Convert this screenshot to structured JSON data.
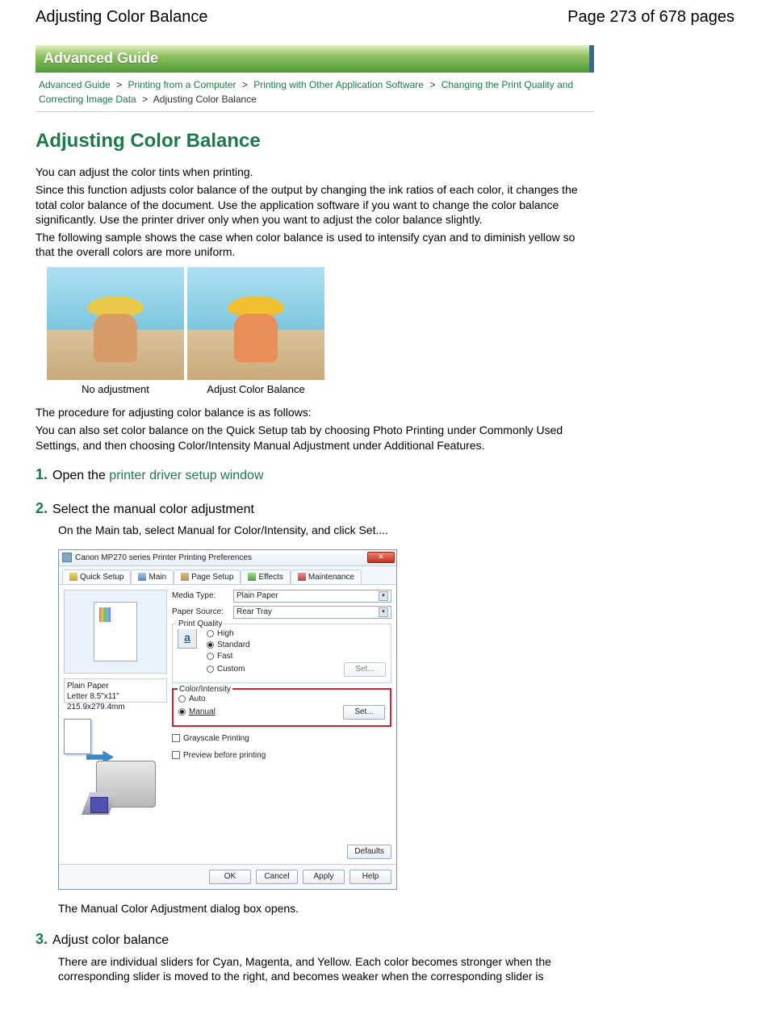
{
  "header": {
    "title_left": "Adjusting Color Balance",
    "title_right": "Page 273 of 678 pages"
  },
  "banner": "Advanced Guide",
  "breadcrumb": {
    "items": [
      {
        "label": "Advanced Guide",
        "link": true
      },
      {
        "label": "Printing from a Computer",
        "link": true
      },
      {
        "label": "Printing with Other Application Software",
        "link": true
      },
      {
        "label": "Changing the Print Quality and Correcting Image Data",
        "link": true
      }
    ],
    "sep": ">",
    "current": "Adjusting Color Balance"
  },
  "topic_title": "Adjusting Color Balance",
  "intro": {
    "p1": "You can adjust the color tints when printing.",
    "p2": "Since this function adjusts color balance of the output by changing the ink ratios of each color, it changes the total color balance of the document. Use the application software if you want to change the color balance significantly. Use the printer driver only when you want to adjust the color balance slightly.",
    "p3": "The following sample shows the case when color balance is used to intensify cyan and to diminish yellow so that the overall colors are more uniform."
  },
  "samples": {
    "caption_left": "No adjustment",
    "caption_right": "Adjust Color Balance"
  },
  "after_samples": {
    "p1": "The procedure for adjusting color balance is as follows:",
    "p2": "You can also set color balance on the Quick Setup tab by choosing Photo Printing under Commonly Used Settings, and then choosing Color/Intensity Manual Adjustment under Additional Features."
  },
  "steps": [
    {
      "num": "1.",
      "title_prefix": "Open the ",
      "title_link": "printer driver setup window",
      "title_suffix": ""
    },
    {
      "num": "2.",
      "title": "Select the manual color adjustment",
      "body1": "On the Main tab, select Manual for Color/Intensity, and click Set....",
      "body2": "The Manual Color Adjustment dialog box opens."
    },
    {
      "num": "3.",
      "title": "Adjust color balance",
      "body1": "There are individual sliders for Cyan, Magenta, and Yellow. Each color becomes stronger when the corresponding slider is moved to the right, and becomes weaker when the corresponding slider is"
    }
  ],
  "dialog": {
    "title": "Canon MP270 series Printer Printing Preferences",
    "tabs": [
      "Quick Setup",
      "Main",
      "Page Setup",
      "Effects",
      "Maintenance"
    ],
    "active_tab": 1,
    "left": {
      "info_line1": "Plain Paper",
      "info_line2": "Letter 8.5\"x11\" 215.9x279.4mm"
    },
    "right": {
      "media_type_label": "Media Type:",
      "media_type_value": "Plain Paper",
      "paper_source_label": "Paper Source:",
      "paper_source_value": "Rear Tray",
      "print_quality_label": "Print Quality",
      "quality_options": [
        "High",
        "Standard",
        "Fast",
        "Custom"
      ],
      "quality_selected": "Standard",
      "quality_set": "Set...",
      "color_intensity_label": "Color/Intensity",
      "ci_options": [
        "Auto",
        "Manual"
      ],
      "ci_selected": "Manual",
      "ci_set": "Set...",
      "grayscale": "Grayscale Printing",
      "preview": "Preview before printing",
      "defaults": "Defaults"
    },
    "footer": [
      "OK",
      "Cancel",
      "Apply",
      "Help"
    ]
  }
}
